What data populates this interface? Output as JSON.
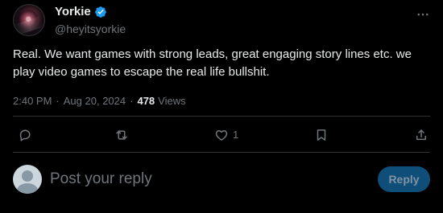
{
  "tweet": {
    "author": {
      "display_name": "Yorkie",
      "username": "@heyitsyorkie",
      "verified_icon": "verified-badge-icon"
    },
    "more_icon": "more-icon",
    "text": "Real. We want games with strong leads, great engaging story lines etc. we play video games to escape the real life bullshit.",
    "meta": {
      "time": "2:40 PM",
      "separator": "·",
      "date": "Aug 20, 2024",
      "views_count": "478",
      "views_label": "Views"
    },
    "actions": {
      "reply_icon": "reply-icon",
      "repost_icon": "repost-icon",
      "like_icon": "heart-icon",
      "like_count": "1",
      "bookmark_icon": "bookmark-icon",
      "share_icon": "share-icon"
    }
  },
  "reply_box": {
    "avatar_icon": "default-avatar-icon",
    "placeholder": "Post your reply",
    "button_label": "Reply"
  },
  "colors": {
    "background": "#000000",
    "text": "#e7e9ea",
    "muted": "#71767b",
    "divider": "#2f3336",
    "verified": "#1d9bf0",
    "reply_button": "#0f4e78"
  }
}
